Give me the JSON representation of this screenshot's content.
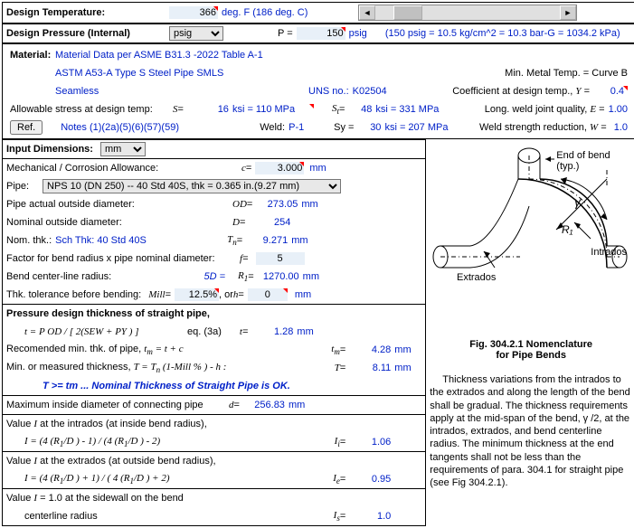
{
  "header": {
    "design_temp_label": "Design Temperature:",
    "design_temp_val": "366",
    "design_temp_unit": "deg. F (186 deg. C)",
    "design_press_label": "Design Pressure (Internal)",
    "press_unit_sel": "psig",
    "P_label": "P =",
    "P_val": "150",
    "P_unit": "psig",
    "P_conv": "(150 psig = 10.5 kg/cm^2  =  10.3 bar-G  = 1034.2 kPa)"
  },
  "material": {
    "label": "Material:",
    "desc": "Material Data per ASME B31.3 -2022  Table A-1",
    "line2": "ASTM A53-A Type S  Steel Pipe SMLS",
    "min_metal": "Min. Metal Temp. = Curve B",
    "line3": "Seamless",
    "uns_label": "UNS no.:",
    "uns_val": "K02504",
    "coeff_label": "Coefficient at design temp., ",
    "coeff_sym": "Y",
    "coeff_val": "0.4",
    "allow_label": "Allowable stress at design temp:",
    "S_label": "S",
    "S_val": "16",
    "S_unit": "ksi = 110 MPa",
    "St_label": "S",
    "St_sub": "t",
    "St_val": "48",
    "St_unit": "ksi = 331 MPa",
    "long_label": "Long. weld joint quality, ",
    "long_sym": "E",
    "long_val": "1.00",
    "ref_btn": "Ref.",
    "notes": "Notes  (1)(2a)(5)(6)(57)(59)",
    "weld_label": "Weld:",
    "weld_val": "P-1",
    "Sy_label": "Sy =",
    "Sy_val": "30",
    "Sy_unit": "ksi = 207 MPa",
    "wsr_label": "Weld strength reduction, ",
    "wsr_sym": "W",
    "wsr_val": "1.0"
  },
  "dims": {
    "header": "Input Dimensions:",
    "unit_sel": "mm",
    "mech_label": "Mechanical / Corrosion Allowance:",
    "c_label": "c",
    "c_val": "3.000",
    "c_unit": "mm",
    "pipe_label": "Pipe:",
    "pipe_sel": "NPS 10 (DN 250) -- 40 Std 40S, thk = 0.365 in.(9.27 mm)",
    "od_label": "Pipe actual outside diameter:",
    "od_sym": "OD",
    "od_val": "273.05",
    "od_unit": "mm",
    "nom_od_label": "Nominal outside diameter:",
    "nom_od_sym": "D",
    "nom_od_val": "254",
    "nom_thk_label": "Nom. thk.:",
    "nom_thk_link": "Sch Thk: 40 Std 40S",
    "Tn_sym": "T",
    "Tn_sub": "n",
    "Tn_val": "9.271",
    "Tn_unit": "mm",
    "factor_label": "Factor for bend radius x pipe nominal diameter:",
    "f_sym": "f",
    "f_val": "5",
    "bend_label": "Bend center-line radius:",
    "bend_note": "5D =",
    "R1_sym": "R",
    "R1_sub": "1",
    "R1_val": "1270.00",
    "R1_unit": "mm",
    "thk_tol_label": "Thk. tolerance before bending:",
    "mill_label": "Mill",
    "mill_val": "12.5%",
    "orh_label": ", or ",
    "orh_sym": "h",
    "orh_val": "0",
    "orh_unit": "mm"
  },
  "press": {
    "header": "Pressure design thickness of straight pipe,",
    "formula": "t = P OD / [ 2(SEW + PY ) ]",
    "eq_ref": "eq. (3a)",
    "t_sym": "t",
    "t_val": "1.28",
    "t_unit": "mm",
    "rec_label": "Recomended min. thk. of pipe,  ",
    "rec_formula": "t",
    "rec_sub": "m",
    "rec_eq": "= t + c",
    "tm_val": "4.28",
    "tm_unit": "mm",
    "meas_label": "Min. or measured thickness, ",
    "meas_formula": "T = T",
    "meas_sub": "n",
    "meas_rest": "(1-Mill % ) - h :",
    "T_sym": "T",
    "T_val": "8.11",
    "T_unit": "mm",
    "ok_msg": "T >= tm ...  Nominal Thickness of Straight Pipe is OK.",
    "maxid_label": "Maximum inside diameter of connecting pipe",
    "d_sym": "d",
    "d_val": "256.83",
    "d_unit": "mm"
  },
  "values_I": {
    "intrados_label": "Value ",
    "I_sym": "I",
    "intrados_rest": " at the intrados (at inside bend radius),",
    "intrados_formula": "I  = (4 (R",
    "intrados_formula2": "/D ) - 1) / (4 (R",
    "intrados_formula3": "/D ) - 2)",
    "Ii_sym": "I",
    "Ii_sub": "i",
    "Ii_val": "1.06",
    "extrados_rest": " at the extrados (at outside bend radius),",
    "extrados_formula": "I  = (4 (R",
    "extrados_formula2": "/D ) + 1) / ( 4 (R",
    "extrados_formula3": "/D ) + 2)",
    "Ie_sym": "I",
    "Ie_sub": "e",
    "Ie_val": "0.95",
    "sidewall_label": "Value ",
    "sidewall_rest": " = 1.0 at the sidewall on the bend",
    "sidewall_line2": "centerline radius",
    "Is_sym": "I",
    "Is_sub": "s",
    "Is_val": "1.0"
  },
  "figure": {
    "end_label": "End of bend (typ.)",
    "gamma": "γ",
    "R1": "R₁",
    "intrados": "Intrados",
    "extrados": "Extrados",
    "caption1": "Fig. 304.2.1     Nomenclature",
    "caption2": "for Pipe Bends",
    "desc": "Thickness variations from the intrados to the extrados and along the length of the bend shall be gradual. The thickness requirements apply at the mid-span of the bend, γ /2, at the intrados, extrados, and bend centerline radius. The minimum thickness at the end tangents shall not be less than the requirements of para. 304.1 for straight pipe (see Fig 304.2.1)."
  }
}
